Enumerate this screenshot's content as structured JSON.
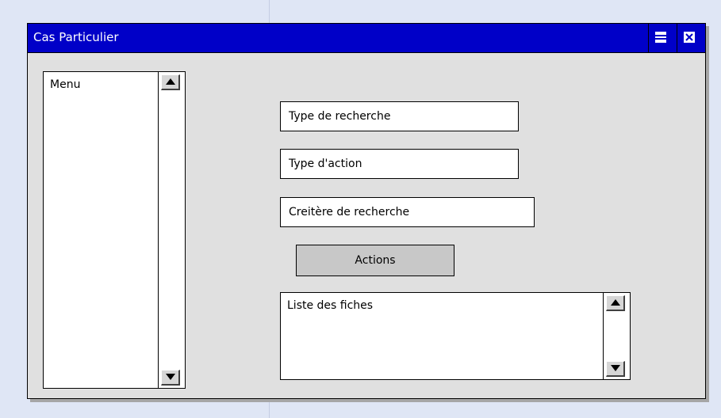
{
  "window": {
    "title": "Cas Particulier",
    "controls": {
      "maximize_icon": "maximize-icon",
      "close_icon": "close-icon"
    },
    "colors": {
      "titlebar": "#0000c8",
      "window_bg": "#e0e0e0",
      "desktop_bg": "#dfe6f5",
      "button_bg": "#c8c8c8"
    }
  },
  "menu": {
    "label": "Menu",
    "scroll_up_icon": "arrow-up-icon",
    "scroll_down_icon": "arrow-down-icon"
  },
  "fields": {
    "search_type": "Type de recherche",
    "action_type": "Type d'action",
    "search_criteria": "Creitère de recherche"
  },
  "actions_button": "Actions",
  "records_list": {
    "label": "Liste des fiches",
    "scroll_up_icon": "arrow-up-icon",
    "scroll_down_icon": "arrow-down-icon"
  }
}
